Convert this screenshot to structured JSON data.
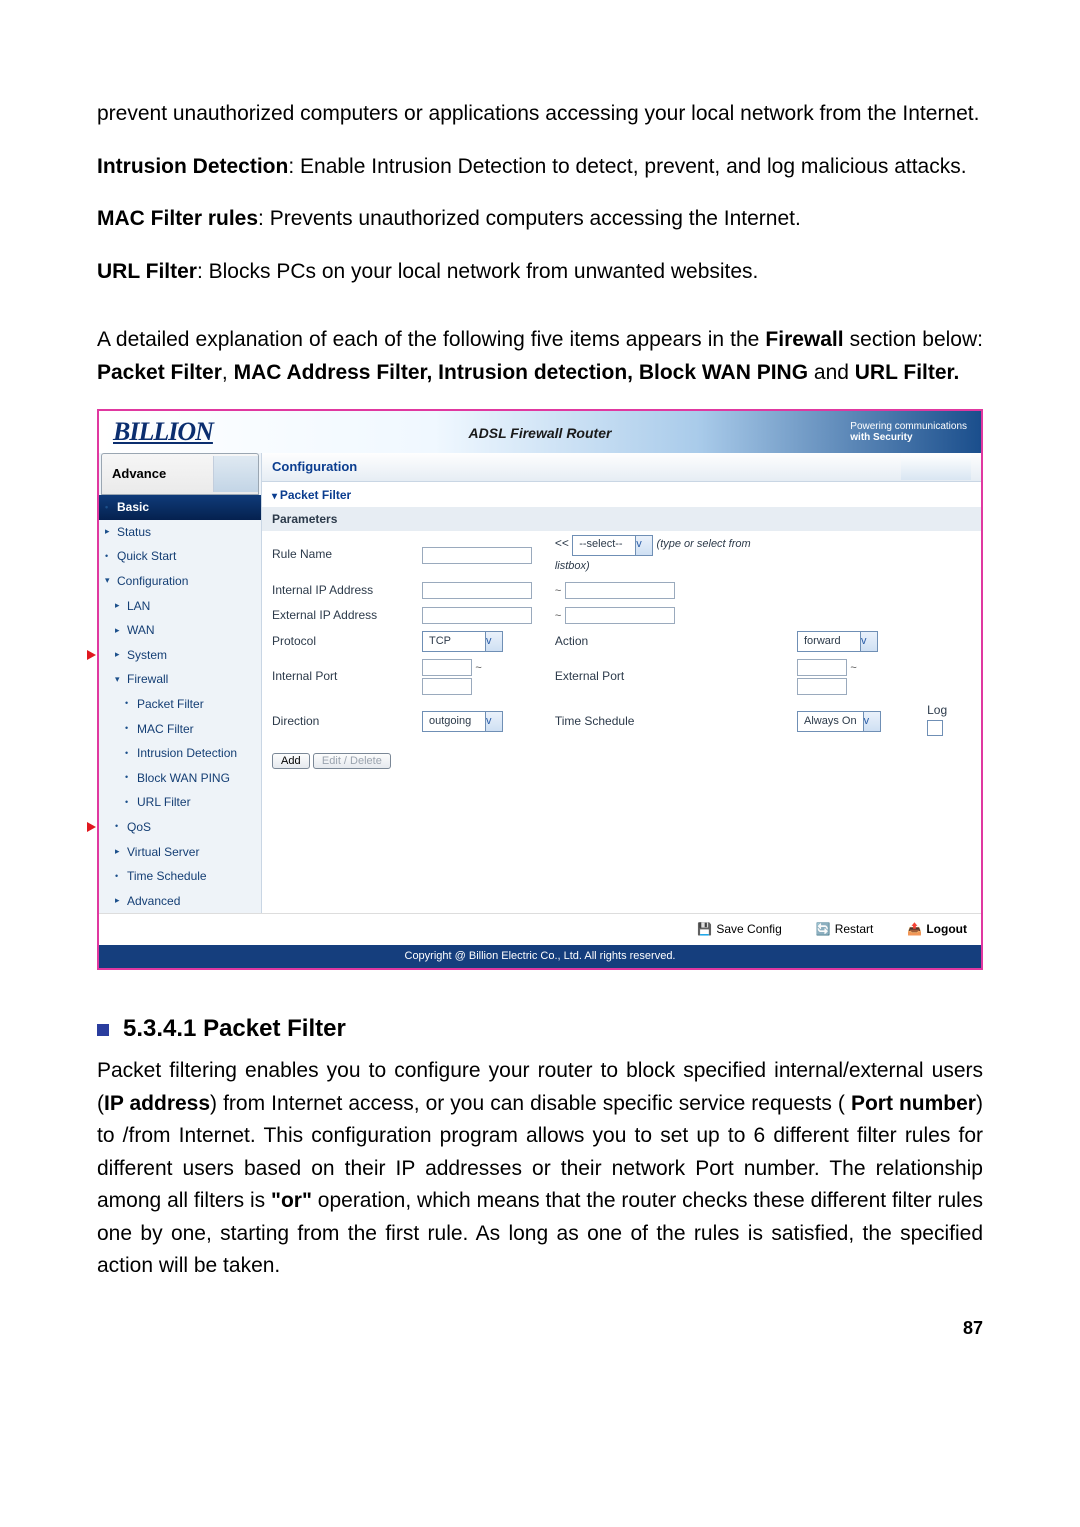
{
  "doc": {
    "p1": "prevent unauthorized computers or applications accessing your local network from the Internet.",
    "p2_b": "Intrusion Detection",
    "p2": ": Enable Intrusion Detection to detect, prevent, and log malicious attacks.",
    "p3_b": "MAC Filter rules",
    "p3": ": Prevents unauthorized computers accessing the Internet.",
    "p4_b": "URL Filter",
    "p4": ": Blocks PCs on your local network from unwanted websites.",
    "p5_a": "A detailed explanation of each of the following five items appears in the ",
    "p5_b1": "Firewall",
    "p5_b": " section below: ",
    "p5_b2": "Packet Filter",
    "p5_c": ", ",
    "p5_b3": "MAC Address Filter, Intrusion detection, Block WAN PING",
    "p5_d": " and ",
    "p5_b4": "URL Filter.",
    "sect_num": "5.3.4.1 Packet Filter",
    "p6_a": "Packet filtering enables you to configure your router to block specified internal/external users (",
    "p6_b1": "IP address",
    "p6_b": ") from Internet access, or you can disable specific service requests (",
    "p6_b2": "Port number",
    "p6_c": ") to /from Internet. This configuration program allows you to set up to 6 different filter rules for different users based on their IP addresses or their network Port number. The relationship among all filters is ",
    "p6_b3": "\"or\"",
    "p6_d": " operation, which means that the router checks these different filter rules one by one, starting from the first rule. As long as one of the rules is satisfied, the specified action will be taken.",
    "pagenum": "87"
  },
  "router": {
    "brand": "BILLION",
    "title": "ADSL Firewall Router",
    "tagline1": "Powering communications",
    "tagline2": "with Security",
    "tab": "Advance",
    "nav": {
      "basic": "Basic",
      "status": "Status",
      "quick": "Quick Start",
      "config": "Configuration",
      "lan": "LAN",
      "wan": "WAN",
      "system": "System",
      "firewall": "Firewall",
      "pfilter": "Packet Filter",
      "mac": "MAC Filter",
      "ids": "Intrusion Detection",
      "bwp": "Block WAN PING",
      "url": "URL Filter",
      "qos": "QoS",
      "vs": "Virtual Server",
      "ts": "Time Schedule",
      "adv": "Advanced"
    },
    "main": {
      "configuration": "Configuration",
      "section": "Packet Filter",
      "parameters": "Parameters",
      "labels": {
        "rule": "Rule Name",
        "iip": "Internal IP Address",
        "eip": "External IP Address",
        "proto": "Protocol",
        "iport": "Internal Port",
        "dir": "Direction",
        "action": "Action",
        "eport": "External Port",
        "ts": "Time Schedule",
        "log": "Log"
      },
      "values": {
        "rule_selected": "--select--",
        "rule_hint": "(type or select from listbox)",
        "arrow": "<<",
        "proto": "TCP",
        "action": "forward",
        "dir": "outgoing",
        "ts": "Always On",
        "tilde": "~"
      },
      "buttons": {
        "add": "Add",
        "ed": "Edit / Delete"
      }
    },
    "footer": {
      "save": "Save Config",
      "restart": "Restart",
      "logout": "Logout"
    },
    "copyright": "Copyright @ Billion Electric Co., Ltd. All rights reserved."
  }
}
